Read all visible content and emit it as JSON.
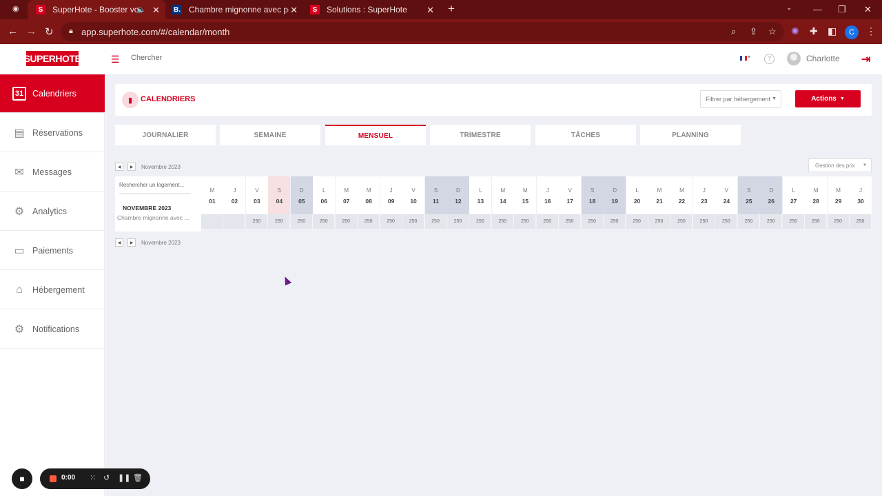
{
  "browser": {
    "tabs": [
      {
        "title": "SuperHote - Booster vos ré",
        "favicon": "S",
        "active": true
      },
      {
        "title": "Chambre mignonne avec petite",
        "favicon": "B.",
        "active": false
      },
      {
        "title": "Solutions : SuperHote",
        "favicon": "S",
        "active": false
      }
    ],
    "url": "app.superhote.com/#/calendar/month",
    "profile_initial": "C"
  },
  "header": {
    "logo": "SUPERHOTE",
    "search_label": "Chercher",
    "user_name": "Charlotte",
    "help": "?"
  },
  "sidebar": {
    "items": [
      {
        "label": "Calendriers",
        "icon": "calendar-31-icon",
        "glyph": "31",
        "active": true
      },
      {
        "label": "Réservations",
        "icon": "reservation-book-icon",
        "glyph": "▤",
        "active": false
      },
      {
        "label": "Messages",
        "icon": "envelope-icon",
        "glyph": "✉",
        "active": false
      },
      {
        "label": "Analytics",
        "icon": "analytics-gears-icon",
        "glyph": "⚙",
        "active": false
      },
      {
        "label": "Paiements",
        "icon": "credit-card-icon",
        "glyph": "▭",
        "active": false
      },
      {
        "label": "Hébergement",
        "icon": "house-icon",
        "glyph": "⌂",
        "active": false
      },
      {
        "label": "Notifications",
        "icon": "notification-gears-icon",
        "glyph": "⚙",
        "active": false
      }
    ]
  },
  "calendar": {
    "title": "CALENDRIERS",
    "filter_label": "Filtrer par hébergement",
    "actions_label": "Actions",
    "view_tabs": [
      "JOURNALIER",
      "SEMAINE",
      "MENSUEL",
      "TRIMESTRE",
      "TÂCHES",
      "PLANNING"
    ],
    "active_view": "MENSUEL",
    "month_nav_label": "Novembre 2023",
    "price_management_label": "Gestion des prix",
    "logement_search_placeholder": "Rechercher un logement...",
    "month_title": "NOVEMBRE 2023",
    "room_name": "Chambre mignonne avec ...",
    "days": [
      {
        "letter": "M",
        "num": "01",
        "price": ""
      },
      {
        "letter": "J",
        "num": "02",
        "price": ""
      },
      {
        "letter": "V",
        "num": "03",
        "price": "250"
      },
      {
        "letter": "S",
        "num": "04",
        "price": "250"
      },
      {
        "letter": "D",
        "num": "05",
        "price": "250"
      },
      {
        "letter": "L",
        "num": "06",
        "price": "250"
      },
      {
        "letter": "M",
        "num": "07",
        "price": "250"
      },
      {
        "letter": "M",
        "num": "08",
        "price": "250"
      },
      {
        "letter": "J",
        "num": "09",
        "price": "250"
      },
      {
        "letter": "V",
        "num": "10",
        "price": "250"
      },
      {
        "letter": "S",
        "num": "11",
        "price": "250"
      },
      {
        "letter": "D",
        "num": "12",
        "price": "250"
      },
      {
        "letter": "L",
        "num": "13",
        "price": "250"
      },
      {
        "letter": "M",
        "num": "14",
        "price": "250"
      },
      {
        "letter": "M",
        "num": "15",
        "price": "250"
      },
      {
        "letter": "J",
        "num": "16",
        "price": "250"
      },
      {
        "letter": "V",
        "num": "17",
        "price": "250"
      },
      {
        "letter": "S",
        "num": "18",
        "price": "250"
      },
      {
        "letter": "D",
        "num": "19",
        "price": "250"
      },
      {
        "letter": "L",
        "num": "20",
        "price": "250"
      },
      {
        "letter": "M",
        "num": "21",
        "price": "250"
      },
      {
        "letter": "M",
        "num": "22",
        "price": "250"
      },
      {
        "letter": "J",
        "num": "23",
        "price": "250"
      },
      {
        "letter": "V",
        "num": "24",
        "price": "250"
      },
      {
        "letter": "S",
        "num": "25",
        "price": "250"
      },
      {
        "letter": "D",
        "num": "26",
        "price": "250"
      },
      {
        "letter": "L",
        "num": "27",
        "price": "250"
      },
      {
        "letter": "M",
        "num": "28",
        "price": "250"
      },
      {
        "letter": "M",
        "num": "29",
        "price": "250"
      },
      {
        "letter": "J",
        "num": "30",
        "price": "250"
      }
    ],
    "today_index": 3
  },
  "recorder": {
    "time": "0:00"
  },
  "colors": {
    "brand": "#d7001f",
    "chrome_dark": "#5f0f0f",
    "chrome": "#7e1616",
    "weekend": "#d3d7e3",
    "today": "#f7e0e2"
  }
}
